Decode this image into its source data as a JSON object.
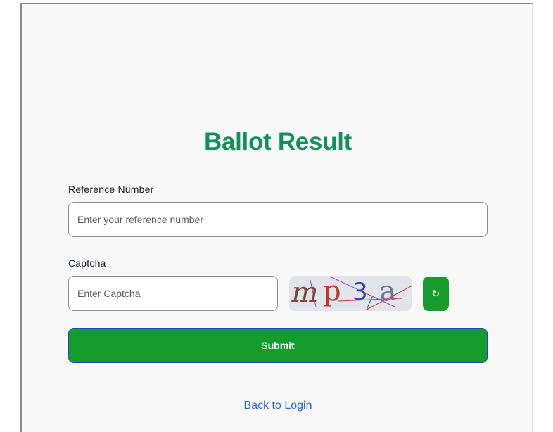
{
  "page": {
    "title": "Ballot Result"
  },
  "form": {
    "reference_label": "Reference Number",
    "reference_placeholder": "Enter your reference number",
    "reference_value": "",
    "captcha_label": "Captcha",
    "captcha_placeholder": "Enter Captcha",
    "captcha_value": "",
    "captcha_chars": [
      "m",
      "p",
      "3",
      "a"
    ],
    "refresh_icon": "↻",
    "submit_label": "Submit"
  },
  "footer": {
    "back_link": "Back to Login"
  },
  "colors": {
    "accent_green": "#169b2d",
    "title_green": "#14915a",
    "link_blue": "#2563d6",
    "captcha_char_colors": [
      "#7a4a3a",
      "#c0392b",
      "#3b3fb0",
      "#6b7a8f"
    ]
  }
}
